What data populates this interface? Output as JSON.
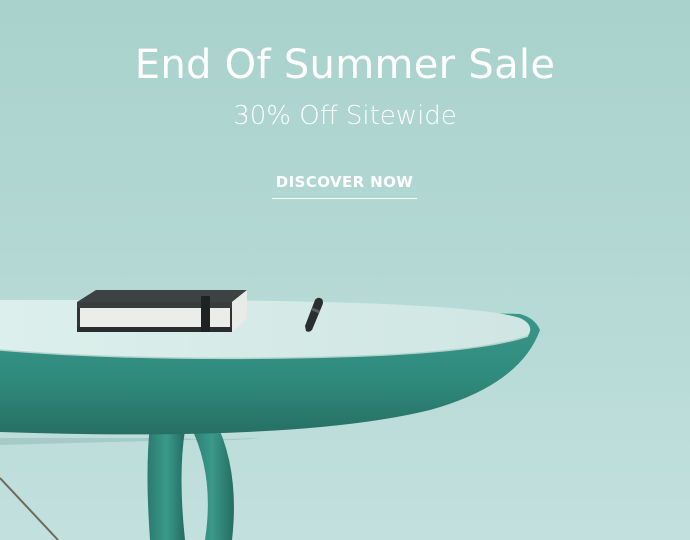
{
  "banner": {
    "headline": "End Of Summer Sale",
    "subline": "30% Off Sitewide",
    "cta_label": "DISCOVER NOW"
  },
  "colors": {
    "background": "#b3d8d4",
    "text": "#ffffff",
    "table_teal": "#2f8c7e",
    "table_top": "#d7eae7"
  }
}
